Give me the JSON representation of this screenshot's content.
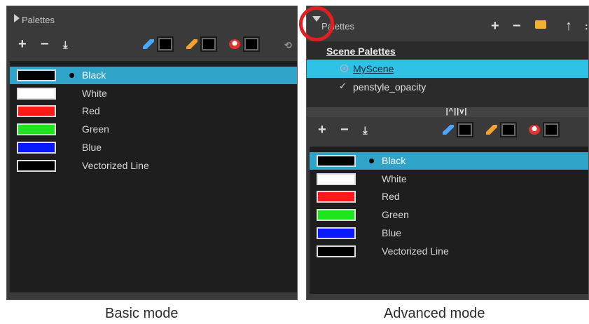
{
  "basic": {
    "title": "Palettes",
    "toolbar": {
      "add": "+",
      "remove": "−",
      "import": "⤓",
      "sync": "⟲"
    },
    "colors": [
      {
        "name": "Black",
        "hex": "#000000",
        "selected": true
      },
      {
        "name": "White",
        "hex": "#ffffff",
        "selected": false
      },
      {
        "name": "Red",
        "hex": "#ff1a1a",
        "selected": false
      },
      {
        "name": "Green",
        "hex": "#1ee51e",
        "selected": false
      },
      {
        "name": "Blue",
        "hex": "#0a1aff",
        "selected": false
      },
      {
        "name": "Vectorized Line",
        "hex": "#000000",
        "selected": false
      }
    ],
    "caption": "Basic mode"
  },
  "advanced": {
    "title": "Palettes",
    "toolbar": {
      "add": "+",
      "remove": "−",
      "folder": "▬",
      "up": "↑",
      "close": ":"
    },
    "scene_palettes_label": "Scene Palettes",
    "scene_palettes": [
      {
        "name": "MyScene",
        "selected": true
      },
      {
        "name": "penstyle_opacity",
        "selected": false
      }
    ],
    "splitter_label": "|^||v|",
    "color_toolbar": {
      "add": "+",
      "remove": "−",
      "import": "⤓"
    },
    "colors": [
      {
        "name": "Black",
        "hex": "#000000",
        "selected": true
      },
      {
        "name": "White",
        "hex": "#ffffff",
        "selected": false
      },
      {
        "name": "Red",
        "hex": "#ff1a1a",
        "selected": false
      },
      {
        "name": "Green",
        "hex": "#1ee51e",
        "selected": false
      },
      {
        "name": "Blue",
        "hex": "#0a1aff",
        "selected": false
      },
      {
        "name": "Vectorized Line",
        "hex": "#000000",
        "selected": false
      }
    ],
    "caption": "Advanced mode"
  },
  "highlight_color": "#e02020"
}
